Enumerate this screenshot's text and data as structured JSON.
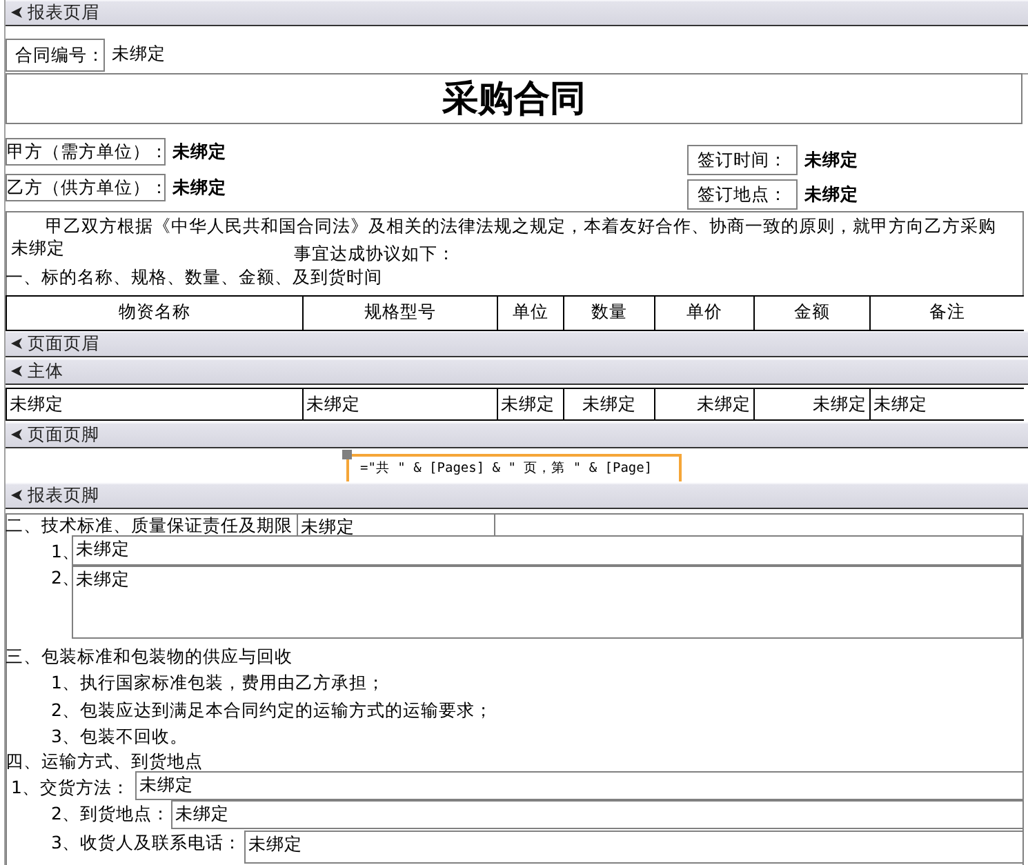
{
  "sections": [
    {
      "title": "报表页眉"
    },
    {
      "title": "页面页眉"
    },
    {
      "title": "主体"
    },
    {
      "title": "页面页脚"
    },
    {
      "title": "报表页脚"
    }
  ],
  "report_header": {
    "contract_no": {
      "label": "合同编号：",
      "value": "未绑定"
    },
    "title": "采购合同",
    "party_a": {
      "label": "甲方（需方单位）：",
      "value": "未绑定"
    },
    "party_b": {
      "label": "乙方（供方单位）：",
      "value": "未绑定"
    },
    "sign_time": {
      "label": "签订时间：",
      "value": "未绑定"
    },
    "sign_place": {
      "label": "签订地点：",
      "value": "未绑定"
    },
    "intro": "甲乙双方根据《中华人民共和国合同法》及相关的法律法规之规定，本着友好合作、协商一致的原则，就甲方向乙方采购",
    "intro_field": "未绑定",
    "intro_end": "事宜达成协议如下：",
    "clause_1": "一、标的名称、规格、数量、金额、及到货时间",
    "columns": [
      "物资名称",
      "规格型号",
      "单位",
      "数量",
      "单价",
      "金额",
      "备注"
    ]
  },
  "detail": {
    "cells": [
      "未绑定",
      "未绑定",
      "未绑定",
      "未绑定",
      "未绑定",
      "未绑定",
      "未绑定"
    ]
  },
  "page_footer": {
    "expression": "=\"共 \" & [Pages] & \" 页，第 \" & [Page]",
    "selected": true
  },
  "report_footer": {
    "clause_2": {
      "label": "二、技术标准、质量保证责任及期限",
      "value": "未绑定"
    },
    "clause_2_items": [
      {
        "label": "1、",
        "value": "未绑定"
      },
      {
        "label": "2、",
        "value": "未绑定"
      }
    ],
    "clause_3": "三、包装标准和包装物的供应与回收",
    "clause_3_items": [
      "1、执行国家标准包装，费用由乙方承担；",
      "2、包装应达到满足本合同约定的运输方式的运输要求；",
      "3、包装不回收。"
    ],
    "clause_4": "四、运输方式、到货地点",
    "clause_4_items": [
      {
        "label": "1、交货方法：",
        "value": "未绑定"
      },
      {
        "label": "2、到货地点：",
        "value": "未绑定"
      },
      {
        "label": "3、收货人及联系电话：",
        "value": "未绑定"
      }
    ]
  }
}
